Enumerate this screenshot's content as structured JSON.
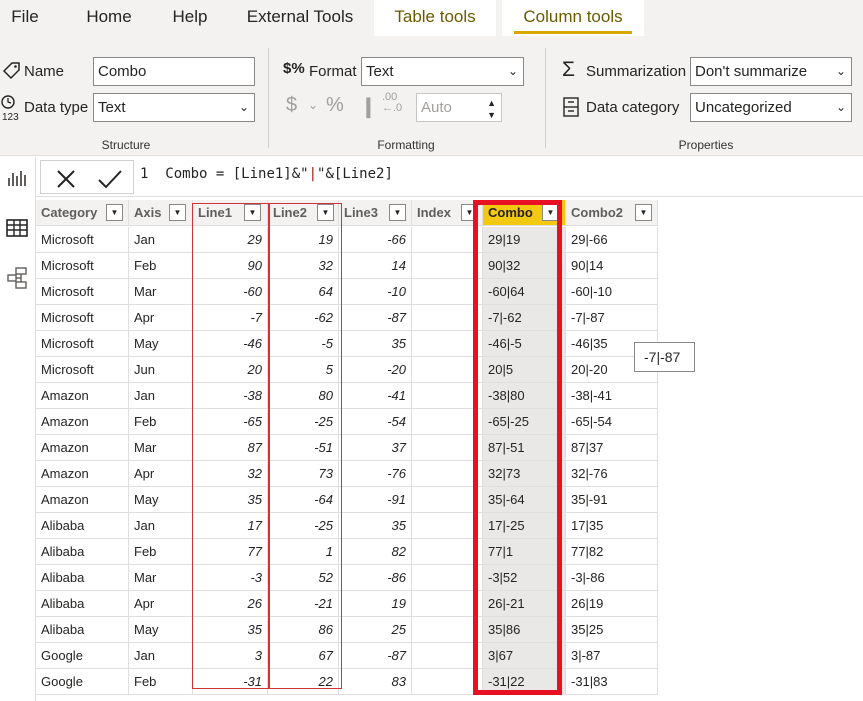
{
  "menu": {
    "file": "File",
    "home": "Home",
    "help": "Help",
    "external": "External Tools",
    "table_tools": "Table tools",
    "column_tools": "Column tools"
  },
  "structure": {
    "name_label": "Name",
    "name_value": "Combo",
    "datatype_label": "Data type",
    "datatype_value": "Text",
    "group": "Structure"
  },
  "formatting": {
    "format_label": "Format",
    "format_value": "Text",
    "decimals_value": "Auto",
    "group": "Formatting"
  },
  "properties": {
    "summarization_label": "Summarization",
    "summarization_value": "Don't summarize",
    "category_label": "Data category",
    "category_value": "Uncategorized",
    "group": "Properties"
  },
  "formula": {
    "line_no": "1",
    "prefix": "Combo = [Line1]&\"",
    "string": "|",
    "suffix": "\"&[Line2]"
  },
  "columns": [
    "Category",
    "Axis",
    "Line1",
    "Line2",
    "Line3",
    "Index",
    "Combo",
    "Combo2"
  ],
  "rows": [
    [
      "Microsoft",
      "Jan",
      "29",
      "19",
      "-66",
      "",
      "29|19",
      "29|-66"
    ],
    [
      "Microsoft",
      "Feb",
      "90",
      "32",
      "14",
      "",
      "90|32",
      "90|14"
    ],
    [
      "Microsoft",
      "Mar",
      "-60",
      "64",
      "-10",
      "",
      "-60|64",
      "-60|-10"
    ],
    [
      "Microsoft",
      "Apr",
      "-7",
      "-62",
      "-87",
      "",
      "-7|-62",
      "-7|-87"
    ],
    [
      "Microsoft",
      "May",
      "-46",
      "-5",
      "35",
      "",
      "-46|-5",
      "-46|35"
    ],
    [
      "Microsoft",
      "Jun",
      "20",
      "5",
      "-20",
      "",
      "20|5",
      "20|-20"
    ],
    [
      "Amazon",
      "Jan",
      "-38",
      "80",
      "-41",
      "",
      "-38|80",
      "-38|-41"
    ],
    [
      "Amazon",
      "Feb",
      "-65",
      "-25",
      "-54",
      "",
      "-65|-25",
      "-65|-54"
    ],
    [
      "Amazon",
      "Mar",
      "87",
      "-51",
      "37",
      "",
      "87|-51",
      "87|37"
    ],
    [
      "Amazon",
      "Apr",
      "32",
      "73",
      "-76",
      "",
      "32|73",
      "32|-76"
    ],
    [
      "Amazon",
      "May",
      "35",
      "-64",
      "-91",
      "",
      "35|-64",
      "35|-91"
    ],
    [
      "Alibaba",
      "Jan",
      "17",
      "-25",
      "35",
      "",
      "17|-25",
      "17|35"
    ],
    [
      "Alibaba",
      "Feb",
      "77",
      "1",
      "82",
      "",
      "77|1",
      "77|82"
    ],
    [
      "Alibaba",
      "Mar",
      "-3",
      "52",
      "-86",
      "",
      "-3|52",
      "-3|-86"
    ],
    [
      "Alibaba",
      "Apr",
      "26",
      "-21",
      "19",
      "",
      "26|-21",
      "26|19"
    ],
    [
      "Alibaba",
      "May",
      "35",
      "86",
      "25",
      "",
      "35|86",
      "35|25"
    ],
    [
      "Google",
      "Jan",
      "3",
      "67",
      "-87",
      "",
      "3|67",
      "3|-87"
    ],
    [
      "Google",
      "Feb",
      "-31",
      "22",
      "83",
      "",
      "-31|22",
      "-31|83"
    ]
  ],
  "tooltip": "-7|-87",
  "colors": {
    "accent": "#f2c811",
    "highlight_red": "#e81123"
  }
}
